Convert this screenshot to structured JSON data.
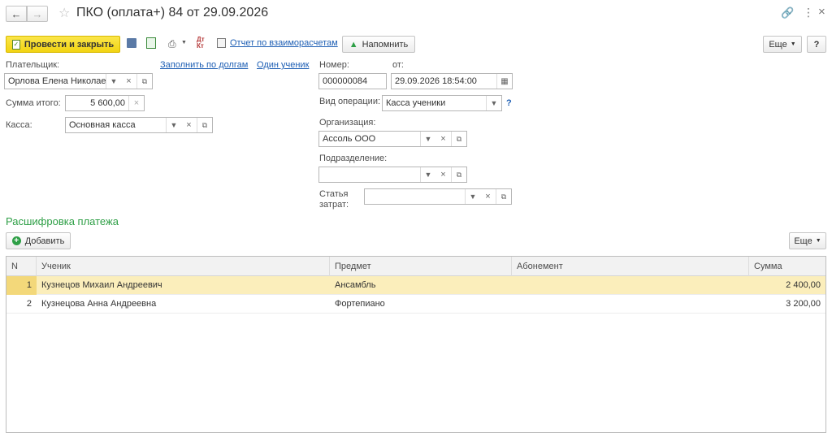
{
  "window": {
    "title": "ПКО (оплата+) 84 от 29.09.2026"
  },
  "toolbar": {
    "post_close_label": "Провести и закрыть",
    "report_link": "Отчет по взаиморасчетам",
    "remind_label": "Напомнить",
    "more_label": "Еще",
    "help_label": "?"
  },
  "form": {
    "payer": {
      "label": "Плательщик:",
      "value": "Орлова Елена Николаевн"
    },
    "fill_by_debts_link": "Заполнить по долгам",
    "one_student_link": "Один ученик",
    "total": {
      "label": "Сумма итого:",
      "value": "5 600,00"
    },
    "cash": {
      "label": "Касса:",
      "value": "Основная касса"
    },
    "number": {
      "label": "Номер:",
      "value": "000000084"
    },
    "date": {
      "label": "от:",
      "value": "29.09.2026 18:54:00"
    },
    "operation": {
      "label": "Вид операции:",
      "value": "Касса ученики",
      "help": "?"
    },
    "organization": {
      "label": "Организация:",
      "value": "Ассоль ООО"
    },
    "department": {
      "label": "Подразделение:",
      "value": ""
    },
    "expense": {
      "label_line1": "Статья",
      "label_line2": "затрат:",
      "value": ""
    }
  },
  "section": {
    "title": "Расшифровка платежа",
    "add_label": "Добавить",
    "more_label": "Еще"
  },
  "table": {
    "columns": [
      "N",
      "Ученик",
      "Предмет",
      "Абонемент",
      "Сумма"
    ],
    "rows": [
      {
        "n": "1",
        "student": "Кузнецов Михаил Андреевич",
        "subject": "Ансамбль",
        "subscription": "",
        "sum": "2 400,00"
      },
      {
        "n": "2",
        "student": "Кузнецова Анна Андреевна",
        "subject": "Фортепиано",
        "subscription": "",
        "sum": "3 200,00"
      }
    ]
  },
  "colors": {
    "accent_yellow": "#f5d916",
    "section_green": "#2e9f46",
    "link_blue": "#1e5fb4",
    "selected_row": "#fbeebb"
  }
}
